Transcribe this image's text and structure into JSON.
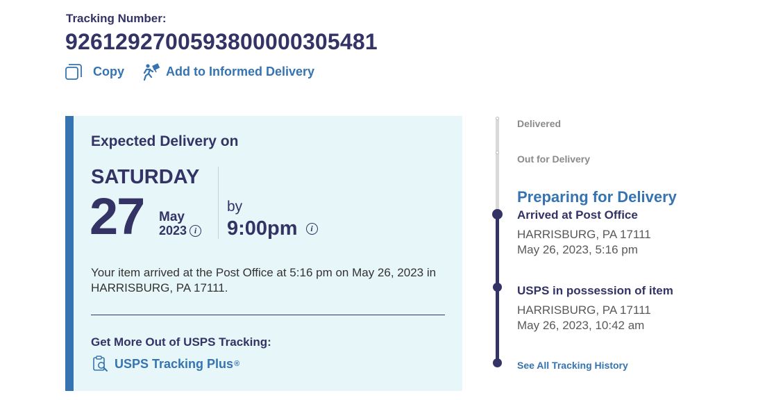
{
  "tracking": {
    "label": "Tracking Number:",
    "number": "9261292700593800000305481",
    "copy_label": "Copy",
    "informed_delivery_label": "Add to Informed Delivery"
  },
  "expected": {
    "title": "Expected Delivery on",
    "weekday": "SATURDAY",
    "day": "27",
    "month": "May",
    "year": "2023",
    "by_label": "by",
    "time": "9:00pm",
    "message": "Your item arrived at the Post Office at 5:16 pm on May 26, 2023 in HARRISBURG, PA 17111.",
    "more_title": "Get More Out of USPS Tracking:",
    "plus_label": "USPS Tracking Plus",
    "plus_mark": "®",
    "info_glyph": "i"
  },
  "timeline": {
    "steps": [
      "Delivered",
      "Out for Delivery"
    ],
    "current_status": "Preparing for Delivery",
    "events": [
      {
        "title": "Arrived at Post Office",
        "location": "HARRISBURG, PA 17111",
        "datetime": "May 26, 2023, 5:16 pm"
      },
      {
        "title": "USPS in possession of item",
        "location": "HARRISBURG, PA 17111",
        "datetime": "May 26, 2023, 10:42 am"
      }
    ],
    "see_all_label": "See All Tracking History"
  },
  "colors": {
    "navy": "#333366",
    "link_blue": "#3573b1",
    "card_bg": "#e7f6f8",
    "timeline_gray": "#d9d9d9"
  },
  "icons": [
    "copy-icon",
    "informed-delivery-icon",
    "info-icon",
    "tracking-plus-icon"
  ]
}
